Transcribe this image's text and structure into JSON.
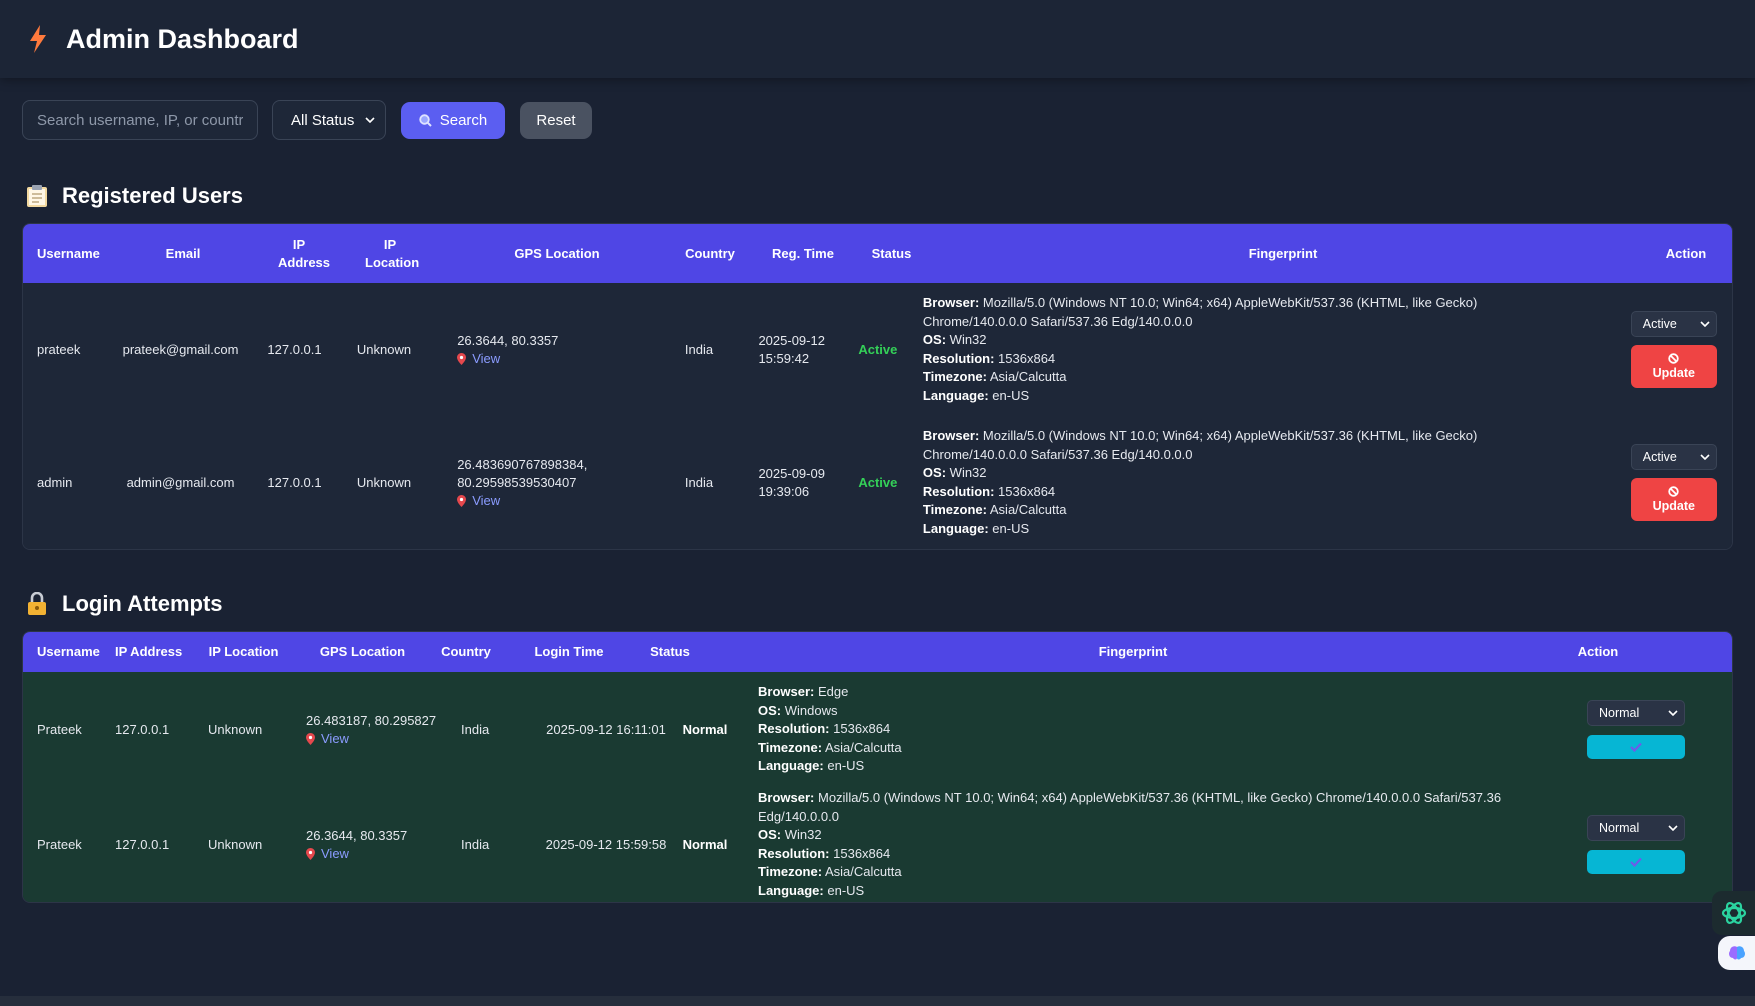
{
  "header": {
    "title": "Admin Dashboard"
  },
  "filters": {
    "search_placeholder": "Search username, IP, or country",
    "status_value": "All Status",
    "search_label": "Search",
    "reset_label": "Reset"
  },
  "users": {
    "title": "Registered Users",
    "columns": {
      "username": "Username",
      "email": "Email",
      "ip_address": "IP Address",
      "ip_location": "IP Location",
      "gps": "GPS Location",
      "country": "Country",
      "reg_time": "Reg. Time",
      "status": "Status",
      "fingerprint": "Fingerprint",
      "action": "Action"
    },
    "rows": [
      {
        "username": "prateek",
        "email": "prateek@gmail.com",
        "ip": "127.0.0.1",
        "ip_location": "Unknown",
        "gps_coords": "26.3644, 80.3357",
        "view": "View",
        "country": "India",
        "reg_date": "2025-09-12",
        "reg_time": "15:59:42",
        "status": "Active",
        "fp_browser": "Mozilla/5.0 (Windows NT 10.0; Win64; x64) AppleWebKit/537.36 (KHTML, like Gecko)",
        "fp_browser2": "Chrome/140.0.0.0 Safari/537.36 Edg/140.0.0.0",
        "fp_os": "Win32",
        "fp_resolution": "1536x864",
        "fp_timezone": "Asia/Calcutta",
        "fp_language": "en-US",
        "action_value": "Active",
        "update_label": "Update"
      },
      {
        "username": "admin",
        "email": "admin@gmail.com",
        "ip": "127.0.0.1",
        "ip_location": "Unknown",
        "gps_coords": "26.483690767898384,",
        "gps_coords2": "80.29598539530407",
        "view": "View",
        "country": "India",
        "reg_date": "2025-09-09",
        "reg_time": "19:39:06",
        "status": "Active",
        "fp_browser": "Mozilla/5.0 (Windows NT 10.0; Win64; x64) AppleWebKit/537.36 (KHTML, like Gecko)",
        "fp_browser2": "Chrome/140.0.0.0 Safari/537.36 Edg/140.0.0.0",
        "fp_os": "Win32",
        "fp_resolution": "1536x864",
        "fp_timezone": "Asia/Calcutta",
        "fp_language": "en-US",
        "action_value": "Active",
        "update_label": "Update"
      }
    ]
  },
  "attempts": {
    "title": "Login Attempts",
    "columns": {
      "username": "Username",
      "ip_address": "IP Address",
      "ip_location": "IP Location",
      "gps": "GPS Location",
      "country": "Country",
      "login_time": "Login Time",
      "status": "Status",
      "fingerprint": "Fingerprint",
      "action": "Action"
    },
    "rows": [
      {
        "username": "Prateek",
        "ip": "127.0.0.1",
        "ip_location": "Unknown",
        "gps_coords": "26.483187, 80.295827",
        "view": "View",
        "country": "India",
        "login_time": "2025-09-12 16:11:01",
        "status": "Normal",
        "fp_browser": "Edge",
        "fp_os": "Windows",
        "fp_resolution": "1536x864",
        "fp_timezone": "Asia/Calcutta",
        "fp_language": "en-US",
        "action_value": "Normal"
      },
      {
        "username": "Prateek",
        "ip": "127.0.0.1",
        "ip_location": "Unknown",
        "gps_coords": "26.3644, 80.3357",
        "view": "View",
        "country": "India",
        "login_time": "2025-09-12 15:59:58",
        "status": "Normal",
        "fp_browser": "Mozilla/5.0 (Windows NT 10.0; Win64; x64) AppleWebKit/537.36 (KHTML, like Gecko) Chrome/140.0.0.0 Safari/537.36 Edg/140.0.0.0",
        "fp_os": "Win32",
        "fp_resolution": "1536x864",
        "fp_timezone": "Asia/Calcutta",
        "fp_language": "en-US",
        "action_value": "Normal"
      }
    ]
  },
  "fingerprint_labels": {
    "browser": "Browser:",
    "os": "OS:",
    "resolution": "Resolution:",
    "timezone": "Timezone:",
    "language": "Language:"
  },
  "colors": {
    "accent": "#4f46e5",
    "active": "#34d058",
    "update": "#ef4444",
    "apply": "#06b6d4"
  }
}
